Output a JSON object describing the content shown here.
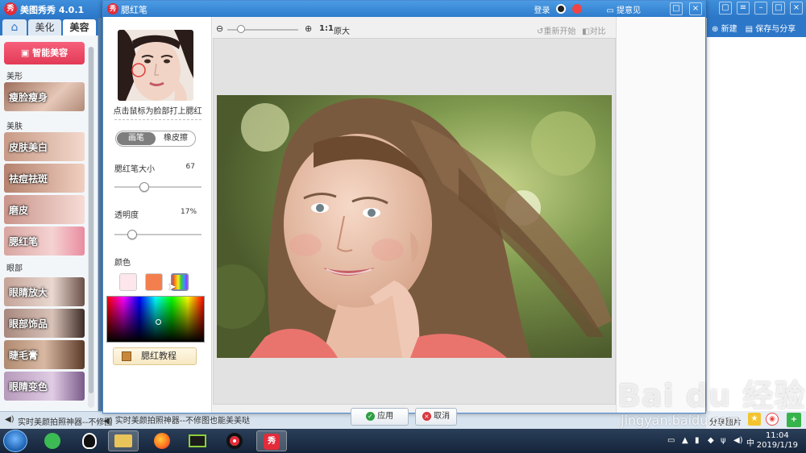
{
  "main_window": {
    "title": "美图秀秀 4.0.1",
    "tabs": [
      {
        "label": "美化"
      },
      {
        "label": "美容"
      }
    ],
    "smart_button": "智能美容",
    "categories": {
      "shape": "美形",
      "skin": "美肤",
      "eyes": "眼部"
    },
    "features": [
      {
        "label": "瘦脸瘦身"
      },
      {
        "label": "皮肤美白"
      },
      {
        "label": "祛痘祛斑"
      },
      {
        "label": "磨皮"
      },
      {
        "label": "腮红笔"
      },
      {
        "label": "眼睛放大"
      },
      {
        "label": "眼部饰品"
      },
      {
        "label": "睫毛膏"
      },
      {
        "label": "眼睛变色"
      }
    ],
    "right_toolbar": {
      "new": "新建",
      "save_share": "保存与分享"
    },
    "share_bar": {
      "label": "分享图片"
    },
    "status_text": "实时美颜拍照神器--不修图"
  },
  "dialog": {
    "title": "腮红笔",
    "login": "登录",
    "feedback": "提意见",
    "hint": "点击鼠标为脸部打上腮红",
    "modes": [
      {
        "label": "画笔",
        "active": true
      },
      {
        "label": "橡皮擦",
        "active": false
      }
    ],
    "brush_size": {
      "label": "腮红笔大小",
      "value": "67",
      "fraction": 0.32
    },
    "opacity": {
      "label": "透明度",
      "value": "17%",
      "fraction": 0.17
    },
    "color_label": "颜色",
    "swatches": [
      "#fde6ec",
      "#f47f4e"
    ],
    "tutorial_button": "腮红教程",
    "zoom": {
      "ratio": "1:1",
      "original": "原大"
    },
    "restart": "重新开始",
    "compare": "对比",
    "apply_button": "应用",
    "cancel_button": "取消",
    "status_text": "实时美颜拍照神器--不修图也能美美哒"
  },
  "watermark": {
    "brand": "Bai du 经验",
    "url": "jingyan.baidu.com"
  },
  "taskbar": {
    "time": "11:04",
    "date": "2019/1/19"
  },
  "colors": {
    "title_blue": "#2c77c8",
    "apply_green": "#2ea043",
    "cancel_red": "#d9363e",
    "accent_pink": "#e23a57"
  }
}
